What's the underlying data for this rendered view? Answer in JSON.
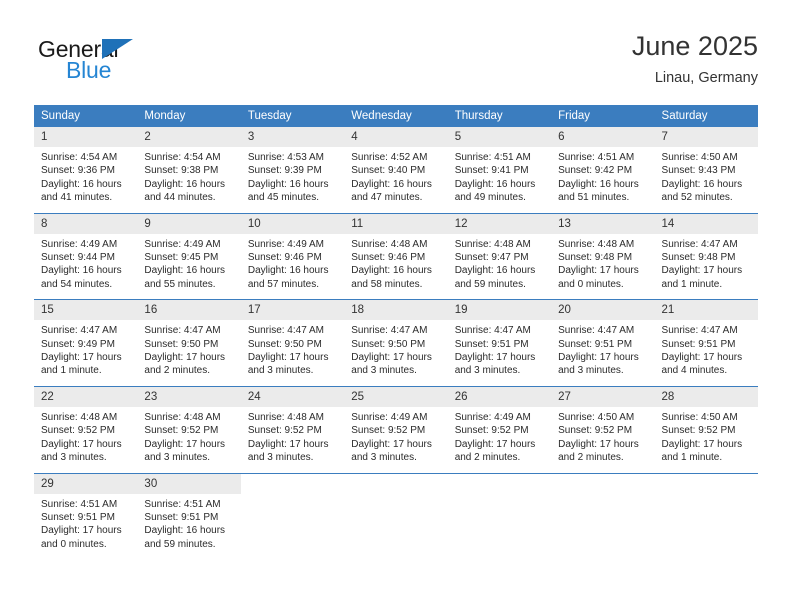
{
  "logo": {
    "word_one": "General",
    "word_two": "Blue",
    "triangle_color": "#1f71b8",
    "blue_color": "#2585d3"
  },
  "header": {
    "title": "June 2025",
    "subtitle": "Linau, Germany"
  },
  "theme": {
    "header_bg": "#3b7dbf",
    "daynum_bg": "#ebebeb",
    "row_divider": "#3b7dbf",
    "text": "#2b2b2b"
  },
  "columns": [
    "Sunday",
    "Monday",
    "Tuesday",
    "Wednesday",
    "Thursday",
    "Friday",
    "Saturday"
  ],
  "weeks": [
    [
      {
        "day": "1",
        "sunrise": "Sunrise: 4:54 AM",
        "sunset": "Sunset: 9:36 PM",
        "daylight_1": "Daylight: 16 hours",
        "daylight_2": "and 41 minutes."
      },
      {
        "day": "2",
        "sunrise": "Sunrise: 4:54 AM",
        "sunset": "Sunset: 9:38 PM",
        "daylight_1": "Daylight: 16 hours",
        "daylight_2": "and 44 minutes."
      },
      {
        "day": "3",
        "sunrise": "Sunrise: 4:53 AM",
        "sunset": "Sunset: 9:39 PM",
        "daylight_1": "Daylight: 16 hours",
        "daylight_2": "and 45 minutes."
      },
      {
        "day": "4",
        "sunrise": "Sunrise: 4:52 AM",
        "sunset": "Sunset: 9:40 PM",
        "daylight_1": "Daylight: 16 hours",
        "daylight_2": "and 47 minutes."
      },
      {
        "day": "5",
        "sunrise": "Sunrise: 4:51 AM",
        "sunset": "Sunset: 9:41 PM",
        "daylight_1": "Daylight: 16 hours",
        "daylight_2": "and 49 minutes."
      },
      {
        "day": "6",
        "sunrise": "Sunrise: 4:51 AM",
        "sunset": "Sunset: 9:42 PM",
        "daylight_1": "Daylight: 16 hours",
        "daylight_2": "and 51 minutes."
      },
      {
        "day": "7",
        "sunrise": "Sunrise: 4:50 AM",
        "sunset": "Sunset: 9:43 PM",
        "daylight_1": "Daylight: 16 hours",
        "daylight_2": "and 52 minutes."
      }
    ],
    [
      {
        "day": "8",
        "sunrise": "Sunrise: 4:49 AM",
        "sunset": "Sunset: 9:44 PM",
        "daylight_1": "Daylight: 16 hours",
        "daylight_2": "and 54 minutes."
      },
      {
        "day": "9",
        "sunrise": "Sunrise: 4:49 AM",
        "sunset": "Sunset: 9:45 PM",
        "daylight_1": "Daylight: 16 hours",
        "daylight_2": "and 55 minutes."
      },
      {
        "day": "10",
        "sunrise": "Sunrise: 4:49 AM",
        "sunset": "Sunset: 9:46 PM",
        "daylight_1": "Daylight: 16 hours",
        "daylight_2": "and 57 minutes."
      },
      {
        "day": "11",
        "sunrise": "Sunrise: 4:48 AM",
        "sunset": "Sunset: 9:46 PM",
        "daylight_1": "Daylight: 16 hours",
        "daylight_2": "and 58 minutes."
      },
      {
        "day": "12",
        "sunrise": "Sunrise: 4:48 AM",
        "sunset": "Sunset: 9:47 PM",
        "daylight_1": "Daylight: 16 hours",
        "daylight_2": "and 59 minutes."
      },
      {
        "day": "13",
        "sunrise": "Sunrise: 4:48 AM",
        "sunset": "Sunset: 9:48 PM",
        "daylight_1": "Daylight: 17 hours",
        "daylight_2": "and 0 minutes."
      },
      {
        "day": "14",
        "sunrise": "Sunrise: 4:47 AM",
        "sunset": "Sunset: 9:48 PM",
        "daylight_1": "Daylight: 17 hours",
        "daylight_2": "and 1 minute."
      }
    ],
    [
      {
        "day": "15",
        "sunrise": "Sunrise: 4:47 AM",
        "sunset": "Sunset: 9:49 PM",
        "daylight_1": "Daylight: 17 hours",
        "daylight_2": "and 1 minute."
      },
      {
        "day": "16",
        "sunrise": "Sunrise: 4:47 AM",
        "sunset": "Sunset: 9:50 PM",
        "daylight_1": "Daylight: 17 hours",
        "daylight_2": "and 2 minutes."
      },
      {
        "day": "17",
        "sunrise": "Sunrise: 4:47 AM",
        "sunset": "Sunset: 9:50 PM",
        "daylight_1": "Daylight: 17 hours",
        "daylight_2": "and 3 minutes."
      },
      {
        "day": "18",
        "sunrise": "Sunrise: 4:47 AM",
        "sunset": "Sunset: 9:50 PM",
        "daylight_1": "Daylight: 17 hours",
        "daylight_2": "and 3 minutes."
      },
      {
        "day": "19",
        "sunrise": "Sunrise: 4:47 AM",
        "sunset": "Sunset: 9:51 PM",
        "daylight_1": "Daylight: 17 hours",
        "daylight_2": "and 3 minutes."
      },
      {
        "day": "20",
        "sunrise": "Sunrise: 4:47 AM",
        "sunset": "Sunset: 9:51 PM",
        "daylight_1": "Daylight: 17 hours",
        "daylight_2": "and 3 minutes."
      },
      {
        "day": "21",
        "sunrise": "Sunrise: 4:47 AM",
        "sunset": "Sunset: 9:51 PM",
        "daylight_1": "Daylight: 17 hours",
        "daylight_2": "and 4 minutes."
      }
    ],
    [
      {
        "day": "22",
        "sunrise": "Sunrise: 4:48 AM",
        "sunset": "Sunset: 9:52 PM",
        "daylight_1": "Daylight: 17 hours",
        "daylight_2": "and 3 minutes."
      },
      {
        "day": "23",
        "sunrise": "Sunrise: 4:48 AM",
        "sunset": "Sunset: 9:52 PM",
        "daylight_1": "Daylight: 17 hours",
        "daylight_2": "and 3 minutes."
      },
      {
        "day": "24",
        "sunrise": "Sunrise: 4:48 AM",
        "sunset": "Sunset: 9:52 PM",
        "daylight_1": "Daylight: 17 hours",
        "daylight_2": "and 3 minutes."
      },
      {
        "day": "25",
        "sunrise": "Sunrise: 4:49 AM",
        "sunset": "Sunset: 9:52 PM",
        "daylight_1": "Daylight: 17 hours",
        "daylight_2": "and 3 minutes."
      },
      {
        "day": "26",
        "sunrise": "Sunrise: 4:49 AM",
        "sunset": "Sunset: 9:52 PM",
        "daylight_1": "Daylight: 17 hours",
        "daylight_2": "and 2 minutes."
      },
      {
        "day": "27",
        "sunrise": "Sunrise: 4:50 AM",
        "sunset": "Sunset: 9:52 PM",
        "daylight_1": "Daylight: 17 hours",
        "daylight_2": "and 2 minutes."
      },
      {
        "day": "28",
        "sunrise": "Sunrise: 4:50 AM",
        "sunset": "Sunset: 9:52 PM",
        "daylight_1": "Daylight: 17 hours",
        "daylight_2": "and 1 minute."
      }
    ],
    [
      {
        "day": "29",
        "sunrise": "Sunrise: 4:51 AM",
        "sunset": "Sunset: 9:51 PM",
        "daylight_1": "Daylight: 17 hours",
        "daylight_2": "and 0 minutes."
      },
      {
        "day": "30",
        "sunrise": "Sunrise: 4:51 AM",
        "sunset": "Sunset: 9:51 PM",
        "daylight_1": "Daylight: 16 hours",
        "daylight_2": "and 59 minutes."
      },
      {
        "day": "",
        "sunrise": "",
        "sunset": "",
        "daylight_1": "",
        "daylight_2": ""
      },
      {
        "day": "",
        "sunrise": "",
        "sunset": "",
        "daylight_1": "",
        "daylight_2": ""
      },
      {
        "day": "",
        "sunrise": "",
        "sunset": "",
        "daylight_1": "",
        "daylight_2": ""
      },
      {
        "day": "",
        "sunrise": "",
        "sunset": "",
        "daylight_1": "",
        "daylight_2": ""
      },
      {
        "day": "",
        "sunrise": "",
        "sunset": "",
        "daylight_1": "",
        "daylight_2": ""
      }
    ]
  ]
}
